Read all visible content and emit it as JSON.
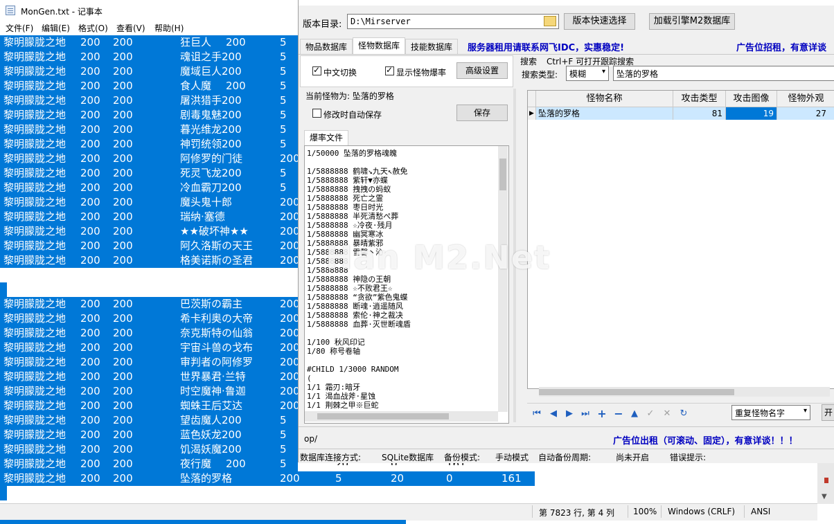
{
  "notepad": {
    "title": "MonGen.txt - 记事本",
    "menu": [
      "文件(F)",
      "编辑(E)",
      "格式(O)",
      "查看(V)",
      "帮助(H)"
    ],
    "lines_top": [
      {
        "map": "黎明朦胧之地",
        "x": "200",
        "y": "200",
        "name": "狂巨人",
        "n1": "200",
        "n2": "5"
      },
      {
        "map": "黎明朦胧之地",
        "x": "200",
        "y": "200",
        "name": "魂诅之手200",
        "n1": "",
        "n2": "5"
      },
      {
        "map": "黎明朦胧之地",
        "x": "200",
        "y": "200",
        "name": "魔域巨人200",
        "n1": "",
        "n2": "5"
      },
      {
        "map": "黎明朦胧之地",
        "x": "200",
        "y": "200",
        "name": "食人魔",
        "n1": "200",
        "n2": "5"
      },
      {
        "map": "黎明朦胧之地",
        "x": "200",
        "y": "200",
        "name": "屠洪猎手200",
        "n1": "",
        "n2": "5"
      },
      {
        "map": "黎明朦胧之地",
        "x": "200",
        "y": "200",
        "name": "剧毒鬼魅200",
        "n1": "",
        "n2": "5"
      },
      {
        "map": "黎明朦胧之地",
        "x": "200",
        "y": "200",
        "name": "暮光维龙200",
        "n1": "",
        "n2": "5"
      },
      {
        "map": "黎明朦胧之地",
        "x": "200",
        "y": "200",
        "name": "神罚统领200",
        "n1": "",
        "n2": "5"
      },
      {
        "map": "黎明朦胧之地",
        "x": "200",
        "y": "200",
        "name": "阿修罗的门徒",
        "n1": "",
        "n2": "200"
      },
      {
        "map": "黎明朦胧之地",
        "x": "200",
        "y": "200",
        "name": "死灵飞龙200",
        "n1": "",
        "n2": "5"
      },
      {
        "map": "黎明朦胧之地",
        "x": "200",
        "y": "200",
        "name": "冷血霸刀200",
        "n1": "",
        "n2": "5"
      },
      {
        "map": "黎明朦胧之地",
        "x": "200",
        "y": "200",
        "name": "魔头鬼十郎",
        "n1": "",
        "n2": "200"
      },
      {
        "map": "黎明朦胧之地",
        "x": "200",
        "y": "200",
        "name": "瑞纳·塞德",
        "n1": "",
        "n2": "200"
      },
      {
        "map": "黎明朦胧之地",
        "x": "200",
        "y": "200",
        "name": "★★破坏神★★",
        "n1": "",
        "n2": "200"
      },
      {
        "map": "黎明朦胧之地",
        "x": "200",
        "y": "200",
        "name": "阿久洛斯の天王",
        "n1": "",
        "n2": "200"
      },
      {
        "map": "黎明朦胧之地",
        "x": "200",
        "y": "200",
        "name": "格美诺斯の圣君",
        "n1": "",
        "n2": "200"
      }
    ],
    "lines_bottom": [
      {
        "map": "黎明朦胧之地",
        "x": "200",
        "y": "200",
        "name": "巴茨斯の霸主",
        "n1": "",
        "n2": "200"
      },
      {
        "map": "黎明朦胧之地",
        "x": "200",
        "y": "200",
        "name": "希卡利奥の大帝",
        "n1": "",
        "n2": "200"
      },
      {
        "map": "黎明朦胧之地",
        "x": "200",
        "y": "200",
        "name": "奈克斯特の仙翁",
        "n1": "",
        "n2": "200"
      },
      {
        "map": "黎明朦胧之地",
        "x": "200",
        "y": "200",
        "name": "宇宙斗兽の戈布",
        "n1": "",
        "n2": "200"
      },
      {
        "map": "黎明朦胧之地",
        "x": "200",
        "y": "200",
        "name": "审判者の阿修罗",
        "n1": "",
        "n2": "200"
      },
      {
        "map": "黎明朦胧之地",
        "x": "200",
        "y": "200",
        "name": "世界暴君·兰特",
        "n1": "",
        "n2": "200"
      },
      {
        "map": "黎明朦胧之地",
        "x": "200",
        "y": "200",
        "name": "时空魔神·鲁迦",
        "n1": "",
        "n2": "200"
      },
      {
        "map": "黎明朦胧之地",
        "x": "200",
        "y": "200",
        "name": "蜘蛛王后艾达",
        "n1": "",
        "n2": "200"
      },
      {
        "map": "黎明朦胧之地",
        "x": "200",
        "y": "200",
        "name": "望齿魔人200",
        "n1": "",
        "n2": "5"
      },
      {
        "map": "黎明朦胧之地",
        "x": "200",
        "y": "200",
        "name": "蓝色妖龙200",
        "n1": "",
        "n2": "5"
      },
      {
        "map": "黎明朦胧之地",
        "x": "200",
        "y": "200",
        "name": "饥渴妖魔200",
        "n1": "",
        "n2": "5"
      },
      {
        "map": "黎明朦胧之地",
        "x": "200",
        "y": "200",
        "name": "夜行魔",
        "n1": "200",
        "n2": "5"
      }
    ],
    "last_line": {
      "map": "黎明朦胧之地",
      "x": "200",
      "y": "200",
      "name": "坠落的罗格",
      "a": "200",
      "b": "5",
      "c": "20",
      "d": "0",
      "e": "161"
    },
    "peek_values": {
      "a": "20",
      "b": "0",
      "c": "161"
    },
    "status": {
      "position": "第 7823 行, 第 4 列",
      "zoom": "100%",
      "eol": "Windows (CRLF)",
      "encoding": "ANSI"
    }
  },
  "tool": {
    "dir_label": "版本目录:",
    "dir_value": "D:\\Mirserver",
    "quick_select": "版本快速选择",
    "load_db": "加载引擎M2数据库",
    "tabs": [
      "物品数据库",
      "怪物数据库",
      "技能数据库"
    ],
    "active_tab": 1,
    "ad_top": "服务器租用请联系网飞IDC，实惠稳定!",
    "ad_top_right": "广告位招租，有意详谈",
    "cb_chinese": "中文切换",
    "cb_show_drop": "显示怪物爆率",
    "advanced": "高级设置",
    "current_monster": "当前怪物为: 坠落的罗格",
    "cb_autosave": "修改时自动保存",
    "save": "保存",
    "drop_tab": "爆率文件",
    "search_title": "搜索",
    "search_hint": "Ctrl+F 可打开跟踪搜索",
    "search_type_label": "搜索类型:",
    "search_type_value": "模糊",
    "search_value": "坠落的罗格",
    "grid_headers": [
      "怪物名称",
      "攻击类型",
      "攻击图像",
      "怪物外观"
    ],
    "grid_row": [
      "坠落的罗格",
      "81",
      "19",
      "27"
    ],
    "drop_lines": [
      "1/50000 坠落的罗格魂魄",
      "",
      "1/5888888 鹤啸↘九天↖赦免",
      "1/5888888 紫轩▼亦蝶",
      "1/5888888 拽拽の蚂蚁",
      "1/5888888 死亡之霊",
      "1/5888888 枣日时光",
      "1/5888888 半死清愁ぺ葬",
      "1/5888888 ☆冷夜·残月",
      "1/5888888 幽冥寒冰",
      "1/5888888 暴晴紫邪",
      "1/5888888 雪馨丶沁",
      "1/5888888 ",
      "1/5888888 ",
      "1/5888888 神隐の王朝",
      "1/5888888 ☆不败君王☆",
      "1/5888888 “贪欲”紫色鬼蝶",
      "1/5888888 断魂·逍遥随风",
      "1/5888888 索伦·神之裁决",
      "1/5888888 血葬·灭世断魂盾",
      "",
      "1/100 秋风印记",
      "1/80 称号卷轴",
      "",
      "#CHILD 1/3000 RANDOM",
      "(",
      "1/1 霜刃:暗牙",
      "1/1 渴血战斧·星蚀",
      "1/1 荆棘之甲※巨蛇"
    ],
    "repeat_name": "重复怪物名字",
    "path_fragment": "op/",
    "ad_bottom": "广告位出租（可滚动、固定），有意详谈！！！",
    "status": {
      "conn_label": "数据库连接方式:",
      "conn_value": "SQLite数据库",
      "backup_label": "备份模式:",
      "backup_value": "手动模式",
      "cycle_label": "自动备份周期:",
      "cycle_value": "尚未开启",
      "error_label": "错误提示:"
    },
    "watermark": "Han M2.Net"
  },
  "colors": {
    "selection": "#0078d7",
    "ad_blue": "#0000c0",
    "row_highlight": "#cce8ff",
    "cell_selected": "#0078d7"
  }
}
